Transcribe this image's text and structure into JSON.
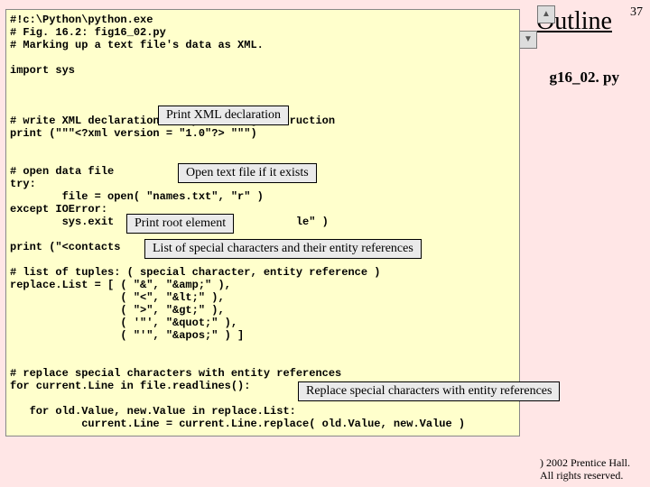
{
  "page_number": "37",
  "outline": "Outline",
  "filename": "g16_02. py",
  "code_lines": {
    "l1": "#!c:\\Python\\python.exe",
    "l2": "# Fig. 16.2: fig16_02.py",
    "l3": "# Marking up a text file's data as XML.",
    "l4": "",
    "l5": "import sys",
    "l6": "",
    "l7": "",
    "l8": "",
    "l9": "# write XML declaration and processing instruction",
    "l10": "print (\"\"\"<?xml version = \"1.0\"?> \"\"\")",
    "l11": "",
    "l12": "",
    "l13": "# open data file",
    "l14": "try:",
    "l15": "        file = open( \"names.txt\", \"r\" )",
    "l16": "except IOError:",
    "l17": "        sys.exit                            le\" )",
    "l18": "",
    "l19": "print (\"<contacts",
    "l20": "",
    "l21": "# list of tuples: ( special character, entity reference )",
    "l22": "replace.List = [ ( \"&\", \"&amp;\" ),",
    "l23": "                 ( \"<\", \"&lt;\" ),",
    "l24": "                 ( \">\", \"&gt;\" ),",
    "l25": "                 ( '\"', \"&quot;\" ),",
    "l26": "                 ( \"'\", \"&apos;\" ) ]",
    "l27": "",
    "l28": "",
    "l29": "# replace special characters with entity references",
    "l30": "for current.Line in file.readlines():",
    "l31": "",
    "l32": "   for old.Value, new.Value in replace.List:",
    "l33": "           current.Line = current.Line.replace( old.Value, new.Value )"
  },
  "callouts": {
    "c1": "Print XML declaration",
    "c2": "Open text file if it exists",
    "c3": "Print root element",
    "c4": "List of special characters and their entity references",
    "c5": "Replace special characters with entity references"
  },
  "footer": {
    "line1": ") 2002 Prentice Hall.",
    "line2": "All rights reserved."
  },
  "icons": {
    "up": "▲",
    "down": "▼"
  }
}
